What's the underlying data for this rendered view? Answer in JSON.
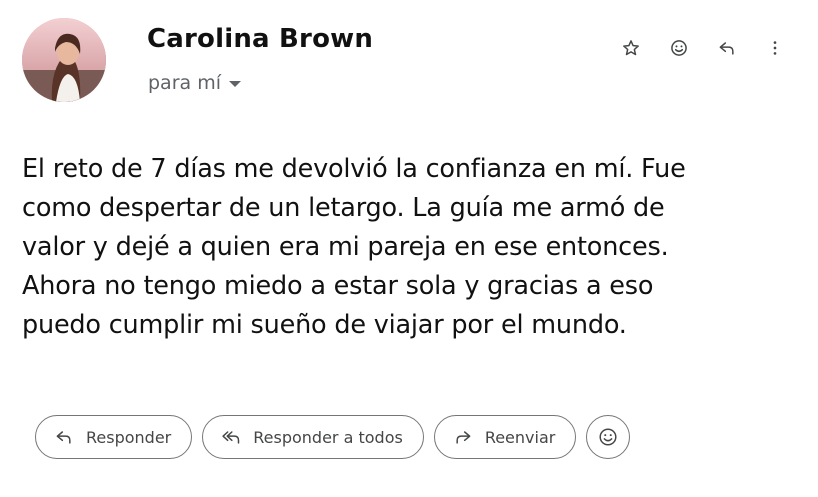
{
  "sender": {
    "name": "Carolina  Brown"
  },
  "recipient": {
    "label": "para mí"
  },
  "header_icons": [
    "star-icon",
    "emoji-icon",
    "reply-icon",
    "more-vert-icon"
  ],
  "message": {
    "lines": [
      "El reto de 7 días me devolvió la confianza en mí. Fue",
      "como despertar de un letargo. La guía me armó de",
      "valor y dejé a quien era mi pareja en ese entonces.",
      "Ahora no tengo miedo a estar sola y gracias a eso",
      "puedo cumplir mi sueño de viajar por el mundo."
    ]
  },
  "actions": {
    "reply_label": "Responder",
    "reply_all_label": "Responder a todos",
    "forward_label": "Reenviar"
  },
  "colors": {
    "icon": "#444746",
    "muted": "#5f6368",
    "border": "#747775"
  }
}
